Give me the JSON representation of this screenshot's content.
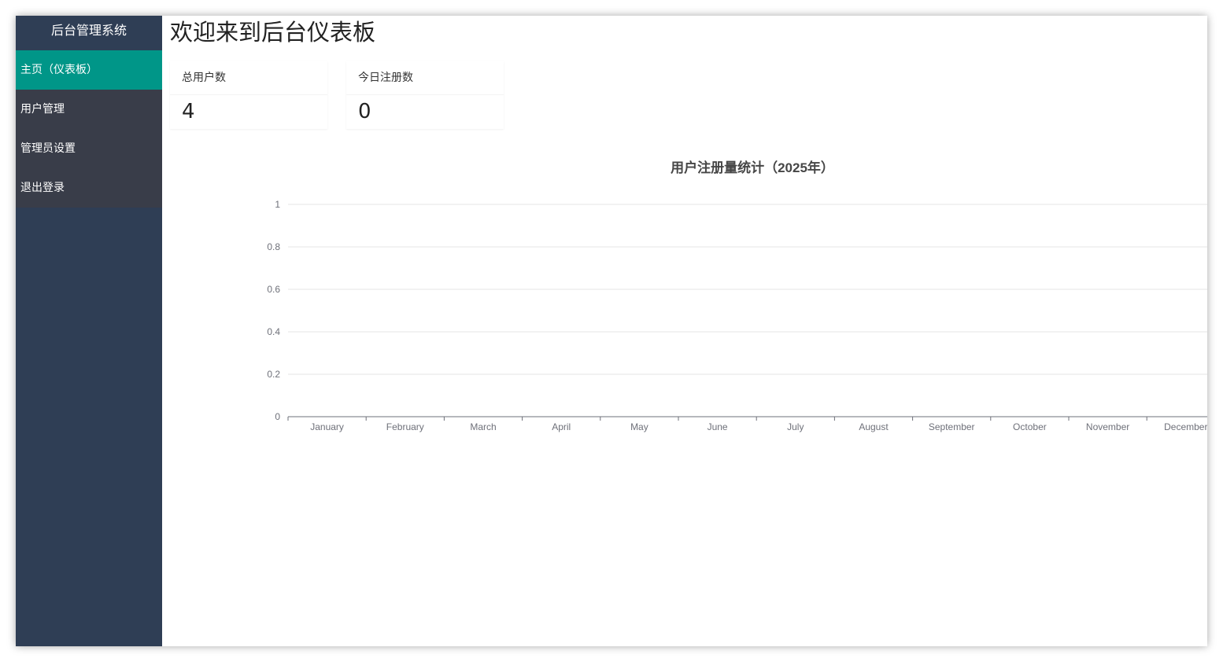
{
  "sidebar": {
    "title": "后台管理系统",
    "items": [
      {
        "label": "主页（仪表板）",
        "active": true
      },
      {
        "label": "用户管理",
        "active": false
      },
      {
        "label": "管理员设置",
        "active": false
      },
      {
        "label": "退出登录",
        "active": false
      }
    ]
  },
  "main": {
    "title": "欢迎来到后台仪表板",
    "cards": [
      {
        "label": "总用户数",
        "value": "4"
      },
      {
        "label": "今日注册数",
        "value": "0"
      }
    ]
  },
  "colors": {
    "sidebar_bg": "#2f3e55",
    "menu_bg": "#393d49",
    "active_bg": "#009688"
  },
  "chart_data": {
    "type": "bar",
    "title": "用户注册量统计（2025年）",
    "categories": [
      "January",
      "February",
      "March",
      "April",
      "May",
      "June",
      "July",
      "August",
      "September",
      "October",
      "November",
      "December"
    ],
    "values": [
      0,
      0,
      0,
      0,
      0,
      0,
      0,
      0,
      0,
      0,
      0,
      0
    ],
    "yticks": [
      "0",
      "0.2",
      "0.4",
      "0.6",
      "0.8",
      "1"
    ],
    "ylim": [
      0,
      1
    ],
    "grid": true
  }
}
